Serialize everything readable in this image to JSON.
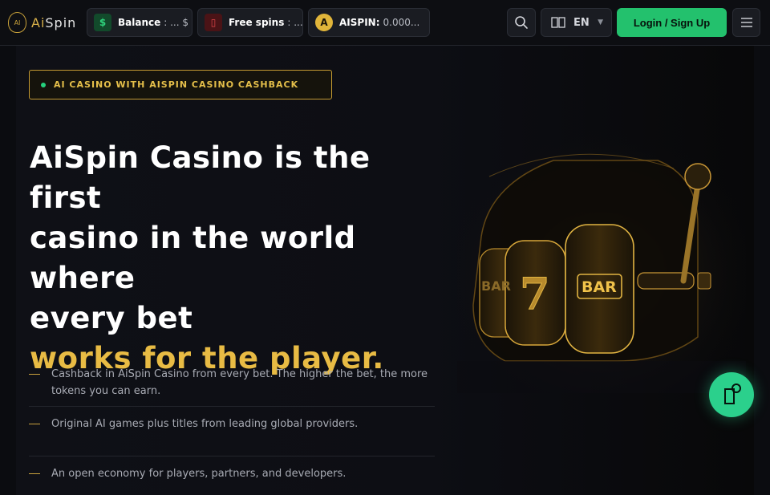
{
  "header": {
    "logo_badge": "AI",
    "logo_text_prefix": "Ai",
    "logo_text_suffix": "Spin",
    "balance": {
      "icon": "$",
      "label": "Balance",
      "value": ": ... $"
    },
    "free_spins": {
      "icon": "▯",
      "label": "Free spins",
      "value": ": ..."
    },
    "token": {
      "icon": "A",
      "label": "AISPIN:",
      "value": "0.000..."
    },
    "language": "EN",
    "login_label": "Login / Sign Up"
  },
  "hero": {
    "badge": "AI CASINO WITH AISPIN CASINO CASHBACK",
    "headline_lines": [
      "AiSpin Casino is the first",
      "casino in the world",
      "where",
      "every bet"
    ],
    "headline_accent": "works for the player.",
    "features": [
      "Cashback in AiSpin Casino from every bet. The higher the bet, the more tokens you can earn.",
      "Original AI games plus titles from leading global providers.",
      "An open economy for players, partners, and developers."
    ],
    "slot_symbols": [
      "BAR",
      "7",
      "BAR"
    ]
  },
  "colors": {
    "accent_gold": "#e8bb44",
    "accent_green": "#23c16d",
    "background": "#0b0c10"
  },
  "icons": [
    "search-icon",
    "book-icon",
    "chevron-down-icon",
    "hamburger-menu-icon",
    "chat-support-icon"
  ]
}
